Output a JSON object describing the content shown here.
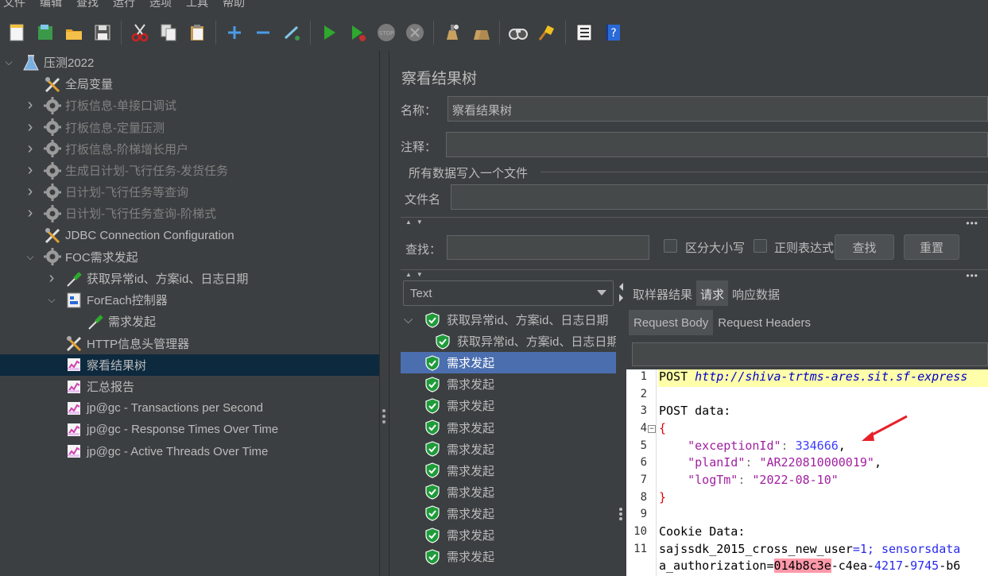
{
  "menubar": [
    "文件",
    "编辑",
    "查找",
    "运行",
    "选项",
    "工具",
    "帮助"
  ],
  "toolbar": [
    {
      "name": "new-icon"
    },
    {
      "name": "templates-icon"
    },
    {
      "name": "open-icon"
    },
    {
      "name": "save-icon"
    },
    {
      "name": "cut-icon"
    },
    {
      "name": "copy-icon"
    },
    {
      "name": "paste-icon"
    },
    {
      "name": "expand-icon"
    },
    {
      "name": "collapse-icon"
    },
    {
      "name": "toggle-icon"
    },
    {
      "name": "start-icon"
    },
    {
      "name": "start-no-pause-icon"
    },
    {
      "name": "stop-icon"
    },
    {
      "name": "shutdown-icon"
    },
    {
      "name": "clear-icon"
    },
    {
      "name": "clear-all-icon"
    },
    {
      "name": "search-icon"
    },
    {
      "name": "reset-search-icon"
    },
    {
      "name": "function-helper-icon"
    },
    {
      "name": "help-icon"
    }
  ],
  "tree": [
    {
      "label": "压测2022",
      "level": 0,
      "arrow": "down",
      "icon": "flask-icon",
      "dim": false
    },
    {
      "label": "全局变量",
      "level": 1,
      "arrow": "",
      "icon": "wrench-icon",
      "dim": false
    },
    {
      "label": "打板信息-单接口调试",
      "level": 1,
      "arrow": "right",
      "icon": "gear-icon",
      "dim": true
    },
    {
      "label": "打板信息-定量压测",
      "level": 1,
      "arrow": "right",
      "icon": "gear-icon",
      "dim": true
    },
    {
      "label": "打板信息-阶梯增长用户",
      "level": 1,
      "arrow": "right",
      "icon": "gear-icon",
      "dim": true
    },
    {
      "label": "生成日计划-飞行任务-发货任务",
      "level": 1,
      "arrow": "right",
      "icon": "gear-icon",
      "dim": true
    },
    {
      "label": "日计划-飞行任务等查询",
      "level": 1,
      "arrow": "right",
      "icon": "gear-icon",
      "dim": true
    },
    {
      "label": "日计划-飞行任务查询-阶梯式",
      "level": 1,
      "arrow": "right",
      "icon": "gear-icon",
      "dim": true
    },
    {
      "label": "JDBC Connection Configuration",
      "level": 1,
      "arrow": "",
      "icon": "wrench-icon",
      "dim": false
    },
    {
      "label": "FOC需求发起",
      "level": 1,
      "arrow": "down",
      "icon": "gear-icon",
      "dim": false
    },
    {
      "label": "获取异常id、方案id、日志日期",
      "level": 2,
      "arrow": "right",
      "icon": "pipette-icon",
      "dim": false
    },
    {
      "label": "ForEach控制器",
      "level": 2,
      "arrow": "down",
      "icon": "controller-icon",
      "dim": false
    },
    {
      "label": "需求发起",
      "level": 3,
      "arrow": "",
      "icon": "pipette-icon",
      "dim": false
    },
    {
      "label": "HTTP信息头管理器",
      "level": 2,
      "arrow": "",
      "icon": "wrench-icon",
      "dim": false
    },
    {
      "label": "察看结果树",
      "level": 2,
      "arrow": "",
      "icon": "chart-icon",
      "dim": false,
      "selected": true
    },
    {
      "label": "汇总报告",
      "level": 2,
      "arrow": "",
      "icon": "chart-icon",
      "dim": false
    },
    {
      "label": "jp@gc - Transactions per Second",
      "level": 2,
      "arrow": "",
      "icon": "chart-icon",
      "dim": false
    },
    {
      "label": "jp@gc - Response Times Over Time",
      "level": 2,
      "arrow": "",
      "icon": "chart-icon",
      "dim": false
    },
    {
      "label": "jp@gc - Active Threads Over Time",
      "level": 2,
      "arrow": "",
      "icon": "chart-icon",
      "dim": false
    }
  ],
  "panel": {
    "title": "察看结果树",
    "name_label": "名称：",
    "name_value": "察看结果树",
    "comment_label": "注释：",
    "comment_value": "",
    "file_group_title": "所有数据写入一个文件",
    "filename_label": "文件名",
    "filename_value": "",
    "search_label": "查找：",
    "search_value": "",
    "case_label": "区分大小写",
    "regex_label": "正则表达式",
    "find_button": "查找",
    "reset_button": "重置",
    "renderer_value": "Text"
  },
  "results": [
    {
      "label": "获取异常id、方案id、日志日期",
      "level": 0,
      "arrow": "down"
    },
    {
      "label": "获取异常id、方案id、日志日期",
      "level": 1,
      "arrow": ""
    },
    {
      "label": "需求发起",
      "level": 0,
      "arrow": "",
      "selected": true
    },
    {
      "label": "需求发起",
      "level": 0,
      "arrow": ""
    },
    {
      "label": "需求发起",
      "level": 0,
      "arrow": ""
    },
    {
      "label": "需求发起",
      "level": 0,
      "arrow": ""
    },
    {
      "label": "需求发起",
      "level": 0,
      "arrow": ""
    },
    {
      "label": "需求发起",
      "level": 0,
      "arrow": ""
    },
    {
      "label": "需求发起",
      "level": 0,
      "arrow": ""
    },
    {
      "label": "需求发起",
      "level": 0,
      "arrow": ""
    },
    {
      "label": "需求发起",
      "level": 0,
      "arrow": ""
    },
    {
      "label": "需求发起",
      "level": 0,
      "arrow": ""
    }
  ],
  "tabs": {
    "sampler_result": "取样器结果",
    "request": "请求",
    "response_data": "响应数据",
    "request_body": "Request Body",
    "request_headers": "Request Headers"
  },
  "editor": {
    "line_numbers": [
      "1",
      "2",
      "3",
      "4",
      "5",
      "6",
      "7",
      "8",
      "9",
      "10",
      "11"
    ],
    "line1_method": "POST ",
    "line1_url": "http://shiva-trtms-ares.sit.sf-express",
    "line3": "POST data:",
    "line4": "{",
    "line5_key": "\"exceptionId\"",
    "line5_colon": ": ",
    "line5_val": "334666",
    "line5_comma": ",",
    "line6_key": "\"planId\"",
    "line6_colon": ": ",
    "line6_val": "\"AR220810000019\"",
    "line6_comma": ",",
    "line7_key": "\"logTm\"",
    "line7_colon": ": ",
    "line7_val": "\"2022-08-10\"",
    "line8": "}",
    "line10": "Cookie Data:",
    "line11_a": "sajssdk_2015_cross_new_user",
    "line11_b": "=1; sensorsdata",
    "line12_a": "a_authorization",
    "line12_b": "=",
    "line12_c": "014b8c3e",
    "line12_d": "-c4ea-",
    "line12_e": "4217",
    "line12_f": "-",
    "line12_g": "9745",
    "line12_h": "-b6"
  }
}
